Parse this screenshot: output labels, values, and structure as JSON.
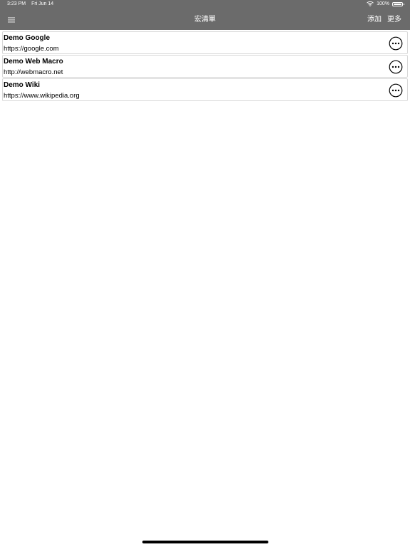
{
  "status_bar": {
    "time": "3:23 PM",
    "date": "Fri Jun 14",
    "battery": "100%"
  },
  "nav": {
    "title": "宏清單",
    "add_label": "添加",
    "more_label": "更多"
  },
  "colors": {
    "nav_background": "#6b6b6b",
    "nav_text": "#ffffff",
    "item_border": "#d8d8d8"
  },
  "macros": [
    {
      "title": "Demo Google",
      "url": "https://google.com"
    },
    {
      "title": "Demo Web Macro",
      "url": "http://webmacro.net"
    },
    {
      "title": "Demo Wiki",
      "url": "https://www.wikipedia.org"
    }
  ]
}
